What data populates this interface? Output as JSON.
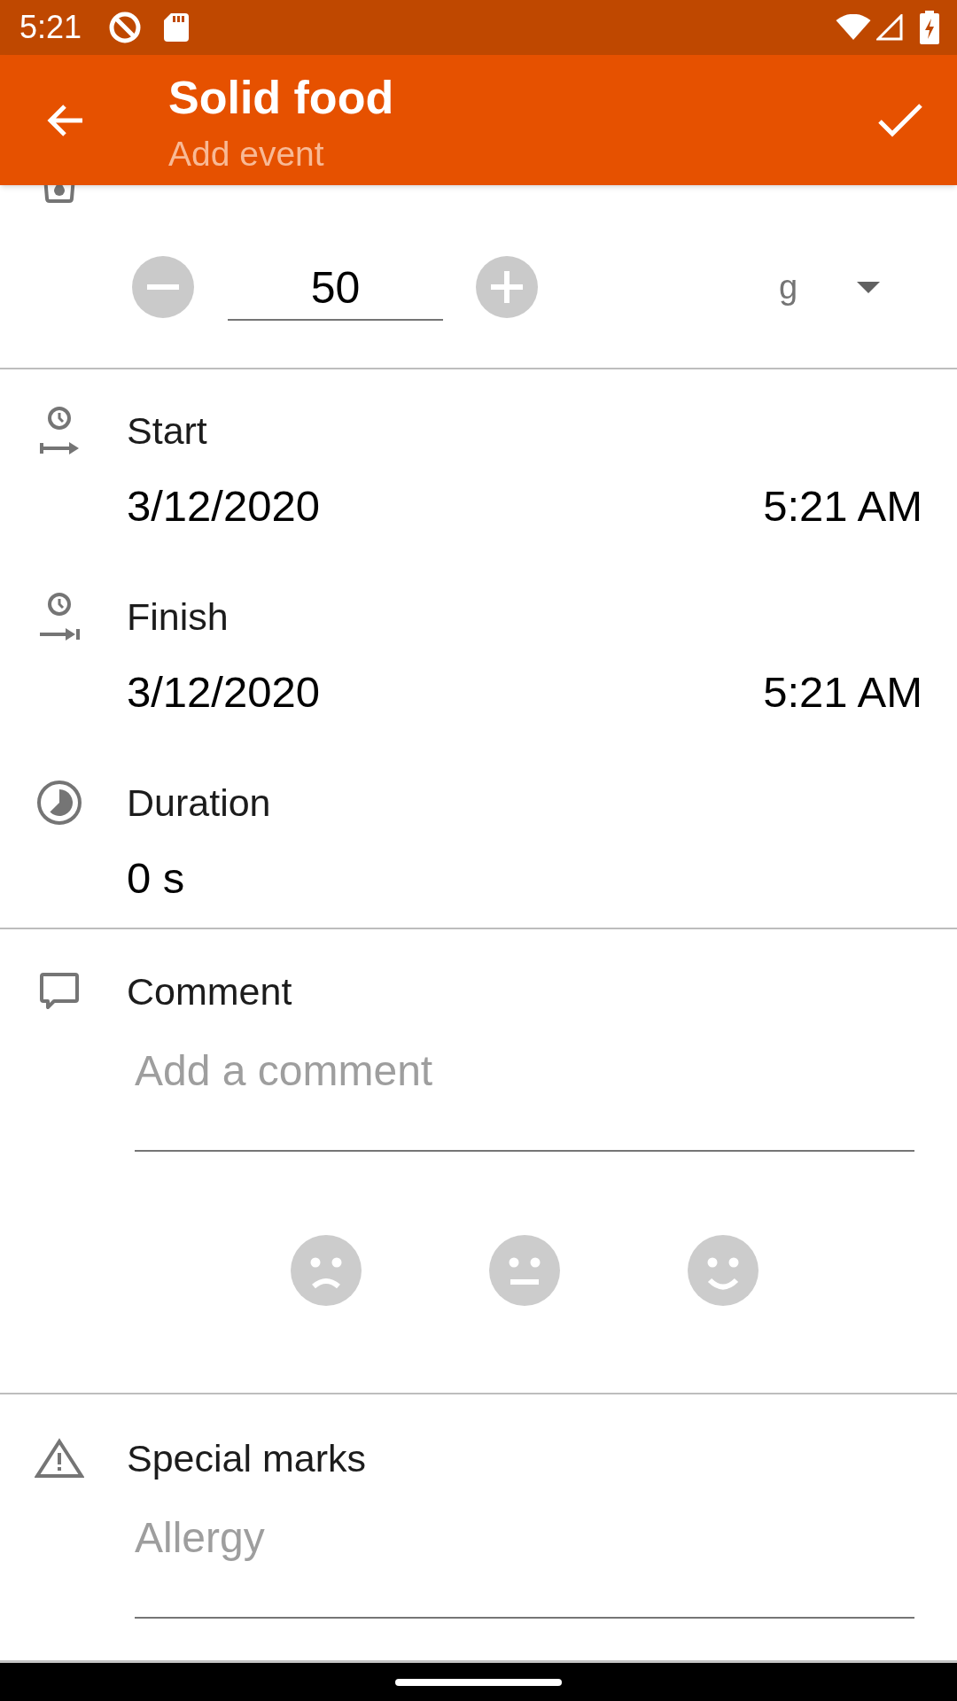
{
  "status_bar": {
    "time": "5:21"
  },
  "app_bar": {
    "title": "Solid food",
    "subtitle": "Add event"
  },
  "volume": {
    "value": "50",
    "unit": "g"
  },
  "timing": [
    {
      "kind": "start",
      "label": "Start",
      "date": "3/12/2020",
      "time": "5:21 AM"
    },
    {
      "kind": "finish",
      "label": "Finish",
      "date": "3/12/2020",
      "time": "5:21 AM"
    },
    {
      "kind": "duration",
      "label": "Duration",
      "value": "0 s"
    }
  ],
  "comment": {
    "label": "Comment",
    "placeholder": "Add a comment"
  },
  "mood_options": [
    {
      "kind": "sad",
      "selected": false
    },
    {
      "kind": "neutral",
      "selected": false
    },
    {
      "kind": "happy",
      "selected": false
    }
  ],
  "special_marks": {
    "label": "Special marks",
    "placeholder": "Allergy"
  }
}
